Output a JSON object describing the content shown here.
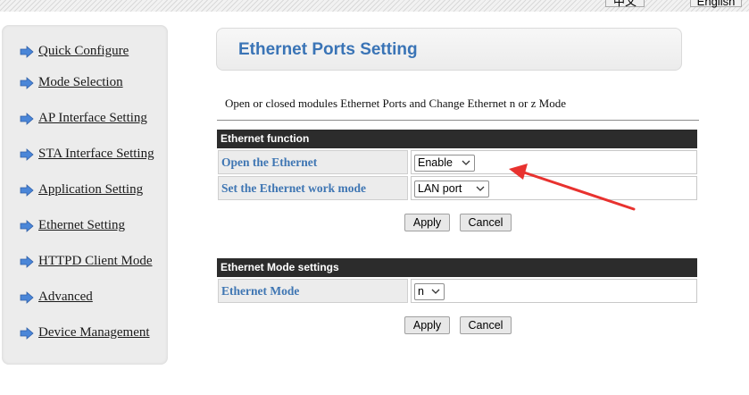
{
  "header": {
    "lang_zh": "中文",
    "lang_en": "English"
  },
  "sidebar": {
    "items": [
      {
        "label": "Quick Configure",
        "icon": "arrow-right-icon"
      },
      {
        "label": "Mode Selection",
        "icon": "arrow-right-icon"
      },
      {
        "label": "AP Interface Setting",
        "icon": "arrow-right-icon"
      },
      {
        "label": "STA Interface Setting",
        "icon": "arrow-right-icon"
      },
      {
        "label": "Application Setting",
        "icon": "arrow-right-icon"
      },
      {
        "label": "Ethernet Setting",
        "icon": "arrow-right-icon"
      },
      {
        "label": "HTTPD Client Mode",
        "icon": "arrow-right-icon"
      },
      {
        "label": "Advanced",
        "icon": "arrow-right-icon"
      },
      {
        "label": "Device Management",
        "icon": "arrow-right-icon"
      }
    ]
  },
  "main": {
    "title": "Ethernet Ports Setting",
    "description": "Open or closed modules Ethernet Ports and Change Ethernet n or z Mode",
    "ethernet_function": {
      "header": "Ethernet function",
      "open_label": "Open the Ethernet",
      "open_value": "Enable",
      "work_mode_label": "Set the Ethernet work mode",
      "work_mode_value": "LAN port",
      "apply": "Apply",
      "cancel": "Cancel"
    },
    "ethernet_mode": {
      "header": "Ethernet Mode settings",
      "mode_label": "Ethernet Mode",
      "mode_value": "n",
      "apply": "Apply",
      "cancel": "Cancel"
    }
  },
  "colors": {
    "accent_text": "#3f76b3",
    "title_text": "#3a74b6",
    "section_header_bg": "#2c2c2c",
    "annotation_arrow": "#e8322f",
    "menu_arrow": "#4a86d8"
  }
}
